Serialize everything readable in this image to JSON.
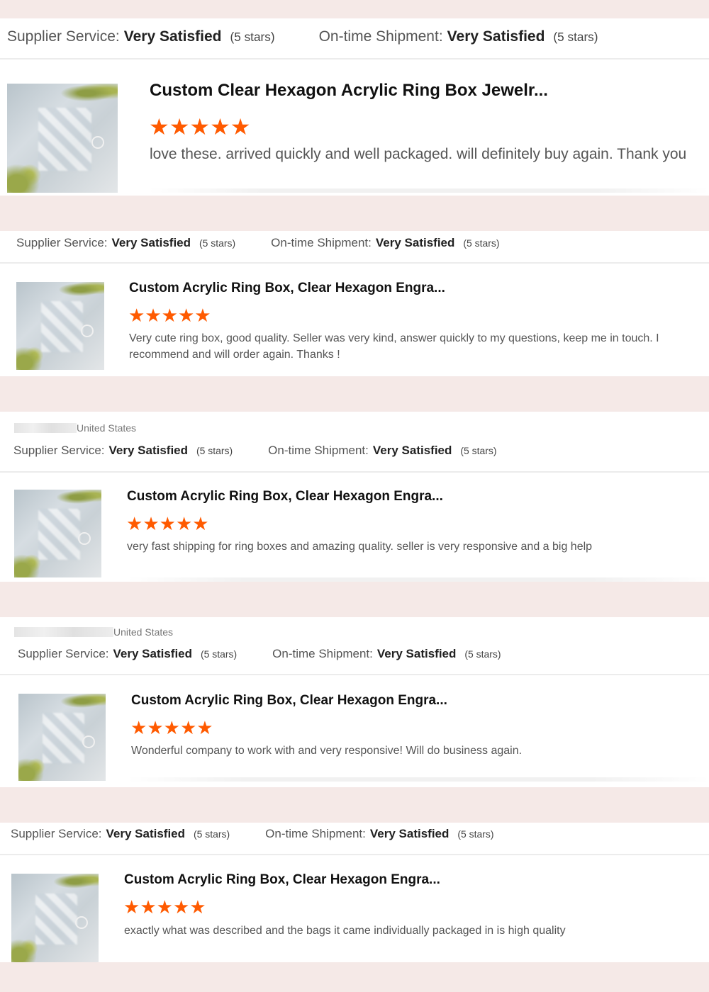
{
  "colors": {
    "page_bg": "#f5e9e7",
    "star": "#ff5a00",
    "card_bg": "#ffffff"
  },
  "icons": {
    "star": "star-icon",
    "thumbnail": "product-thumbnail"
  },
  "reviews": [
    {
      "location": "",
      "supplier_label": "Supplier Service:",
      "supplier_value": "Very Satisfied",
      "supplier_stars": "(5 stars)",
      "shipment_label": "On-time Shipment:",
      "shipment_value": "Very Satisfied",
      "shipment_stars": "(5 stars)",
      "product_title": "Custom Clear Hexagon Acrylic Ring Box Jewelr...",
      "rating": 5,
      "comment": "love these. arrived quickly and well packaged. will definitely buy again. Thank you"
    },
    {
      "location": "",
      "supplier_label": "Supplier Service:",
      "supplier_value": "Very Satisfied",
      "supplier_stars": "(5 stars)",
      "shipment_label": "On-time Shipment:",
      "shipment_value": "Very Satisfied",
      "shipment_stars": "(5 stars)",
      "product_title": "Custom Acrylic Ring Box, Clear Hexagon Engra...",
      "rating": 5,
      "comment": "Very cute ring box, good quality. Seller was very kind, answer quickly to my questions, keep me in touch. I recommend and will order again. Thanks !"
    },
    {
      "location": "United States",
      "supplier_label": "Supplier Service:",
      "supplier_value": "Very Satisfied",
      "supplier_stars": "(5 stars)",
      "shipment_label": "On-time Shipment:",
      "shipment_value": "Very Satisfied",
      "shipment_stars": "(5 stars)",
      "product_title": "Custom Acrylic Ring Box, Clear Hexagon Engra...",
      "rating": 5,
      "comment": "very fast shipping for ring boxes and amazing quality. seller is very responsive and a big help"
    },
    {
      "location": "United States",
      "supplier_label": "Supplier Service:",
      "supplier_value": "Very Satisfied",
      "supplier_stars": "(5 stars)",
      "shipment_label": "On-time Shipment:",
      "shipment_value": "Very Satisfied",
      "shipment_stars": "(5 stars)",
      "product_title": "Custom Acrylic Ring Box, Clear Hexagon Engra...",
      "rating": 5,
      "comment": "Wonderful company to work with and very responsive! Will do business again."
    },
    {
      "location": "",
      "supplier_label": "Supplier Service:",
      "supplier_value": "Very Satisfied",
      "supplier_stars": "(5 stars)",
      "shipment_label": "On-time Shipment:",
      "shipment_value": "Very Satisfied",
      "shipment_stars": "(5 stars)",
      "product_title": "Custom Acrylic Ring Box, Clear Hexagon Engra...",
      "rating": 5,
      "comment": "exactly what was described and the bags it came individually packaged in is high quality"
    }
  ]
}
